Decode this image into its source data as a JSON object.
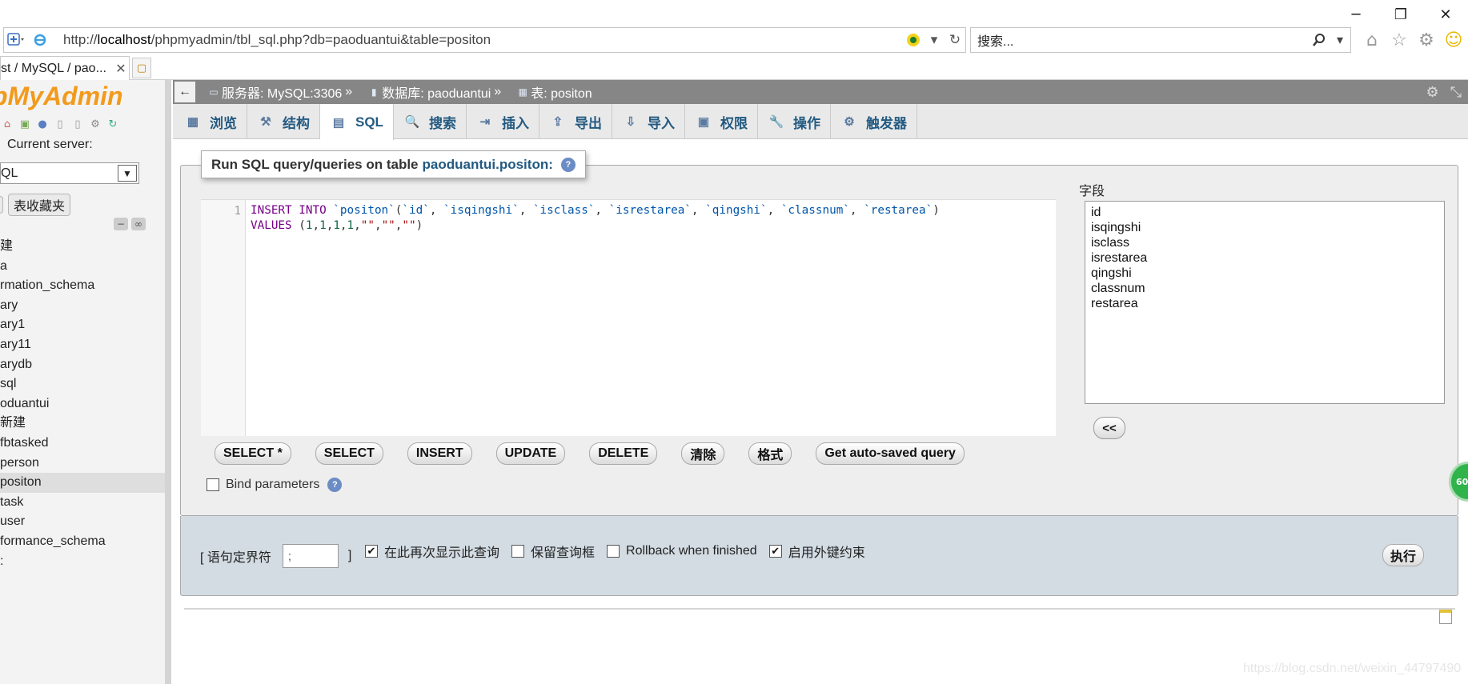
{
  "browser": {
    "url_prefix": "http://",
    "url_host": "localhost",
    "url_path": "/phpmyadmin/tbl_sql.php?db=paoduantui&table=positon",
    "search_placeholder": "搜索...",
    "tab_title": "st / MySQL / pao...",
    "tab_close": "✕",
    "minimize": "─",
    "restore": "❐",
    "close": "✕"
  },
  "nav": {
    "logo_prefix": "p",
    "logo_text": "MyAdmin",
    "current_server_label": "Current server:",
    "server_select_value": "QL",
    "favorites_label": "表收藏夹",
    "databases": [
      "建",
      "a",
      "rmation_schema",
      "ary",
      "ary1",
      "ary11",
      "arydb",
      "sql",
      "oduantui",
      "新建",
      "fbtasked",
      "person",
      "positon",
      "task",
      "user",
      "formance_schema",
      ":"
    ],
    "active_database_index": 12
  },
  "breadcrumb": {
    "server": "服务器: MySQL:3306",
    "database": "数据库: paoduantui",
    "table": "表: positon",
    "sep": "»"
  },
  "tabs": [
    {
      "label": "浏览",
      "icon": "▦"
    },
    {
      "label": "结构",
      "icon": "⚒"
    },
    {
      "label": "SQL",
      "icon": "▤"
    },
    {
      "label": "搜索",
      "icon": "🔍"
    },
    {
      "label": "插入",
      "icon": "⇥"
    },
    {
      "label": "导出",
      "icon": "⇪"
    },
    {
      "label": "导入",
      "icon": "⇩"
    },
    {
      "label": "权限",
      "icon": "▣"
    },
    {
      "label": "操作",
      "icon": "🔧"
    },
    {
      "label": "触发器",
      "icon": "⚙"
    }
  ],
  "active_tab_index": 2,
  "sql_panel": {
    "legend_prefix": "Run SQL query/queries on table",
    "legend_table": "paoduantui.positon:",
    "line_number": "1",
    "fields_label": "字段",
    "fields": [
      "id",
      "isqingshi",
      "isclass",
      "isrestarea",
      "qingshi",
      "classnum",
      "restarea"
    ],
    "insert_field_button": "<<",
    "buttons": [
      "SELECT *",
      "SELECT",
      "INSERT",
      "UPDATE",
      "DELETE",
      "清除",
      "格式",
      "Get auto-saved query"
    ],
    "bind_parameters_label": "Bind parameters"
  },
  "footer": {
    "delimiter_label_left": "[ 语句定界符",
    "delimiter_value": ";",
    "delimiter_label_right": "]",
    "options": [
      {
        "label": "在此再次显示此查询",
        "checked": true
      },
      {
        "label": "保留查询框",
        "checked": false
      },
      {
        "label": "Rollback when finished",
        "checked": false
      },
      {
        "label": "启用外键约束",
        "checked": true
      }
    ],
    "go_button": "执行"
  },
  "badge_text": "60",
  "watermark": "https://blog.csdn.net/weixin_44797490",
  "colors": {
    "link": "#235a81",
    "breadcrumb_bg": "#868686",
    "footer_bg": "#d3dce3",
    "sql_keyword": "#770088",
    "sql_identifier": "#0055aa"
  }
}
